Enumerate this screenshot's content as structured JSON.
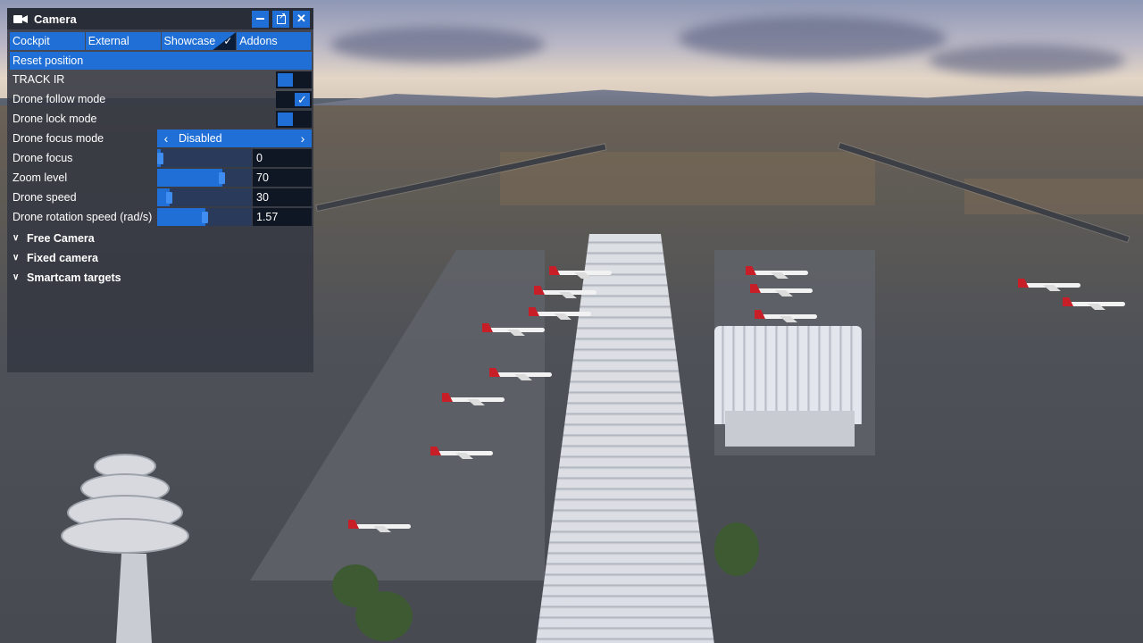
{
  "panel": {
    "title": "Camera",
    "title_icon": "video-camera-icon",
    "window_buttons": {
      "minimize_icon": "minimize-icon",
      "popout_icon": "popout-window-icon",
      "close_label": "✕"
    },
    "tabs": [
      {
        "label": "Cockpit",
        "active": false
      },
      {
        "label": "External",
        "active": false
      },
      {
        "label": "Showcase",
        "active": true
      },
      {
        "label": "Addons",
        "active": false
      }
    ],
    "reset_label": "Reset position",
    "toggles": [
      {
        "label": "TRACK IR",
        "on": false
      },
      {
        "label": "Drone follow mode",
        "on": true
      },
      {
        "label": "Drone lock mode",
        "on": false
      }
    ],
    "focus_mode": {
      "label": "Drone focus mode",
      "value": "Disabled",
      "prev": "‹",
      "next": "›"
    },
    "sliders": [
      {
        "label": "Drone focus",
        "value": "0",
        "fraction": 0.0
      },
      {
        "label": "Zoom level",
        "value": "70",
        "fraction": 0.7
      },
      {
        "label": "Drone speed",
        "value": "30",
        "fraction": 0.1
      },
      {
        "label": "Drone rotation speed (rad/s)",
        "value": "1.57",
        "fraction": 0.5
      }
    ],
    "sections": [
      {
        "label": "Free Camera",
        "icon": "chevron-down-icon"
      },
      {
        "label": "Fixed camera",
        "icon": "chevron-down-icon"
      },
      {
        "label": "Smartcam targets",
        "icon": "chevron-down-icon"
      }
    ]
  },
  "colors": {
    "accent": "#1f6fd6",
    "panel_bg": "#343842",
    "field_bg": "#0f1624"
  }
}
